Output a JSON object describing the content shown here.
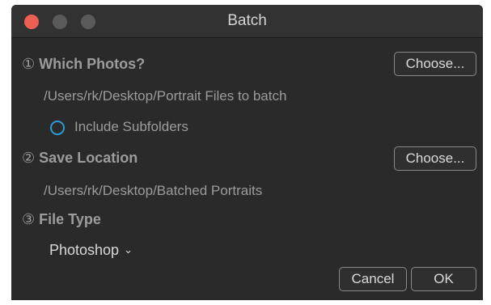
{
  "window": {
    "title": "Batch"
  },
  "sections": {
    "photos": {
      "number": "①",
      "heading": "Which Photos?",
      "choose_label": "Choose...",
      "path": "/Users/rk/Desktop/Portrait Files to batch",
      "include_subfolders_label": "Include Subfolders"
    },
    "save": {
      "number": "②",
      "heading": "Save Location",
      "choose_label": "Choose...",
      "path": "/Users/rk/Desktop/Batched Portraits"
    },
    "filetype": {
      "number": "③",
      "heading": "File Type",
      "selected": "Photoshop"
    }
  },
  "footer": {
    "cancel_label": "Cancel",
    "ok_label": "OK"
  },
  "colors": {
    "background": "#2a2a2a",
    "close_button": "#ed5f53",
    "radio_accent": "#2f9bd6"
  },
  "icons": {
    "chevron": "chevron-down-icon"
  }
}
